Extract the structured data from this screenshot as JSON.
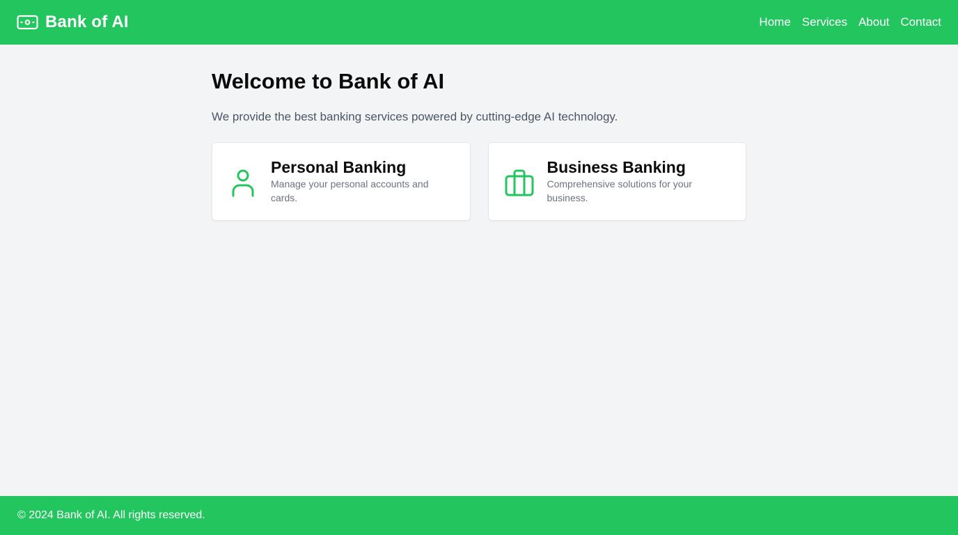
{
  "header": {
    "brand_name": "Bank of AI",
    "brand_icon": "banknote-icon",
    "nav": [
      {
        "label": "Home"
      },
      {
        "label": "Services"
      },
      {
        "label": "About"
      },
      {
        "label": "Contact"
      }
    ]
  },
  "main": {
    "title": "Welcome to Bank of AI",
    "intro": "We provide the best banking services powered by cutting-edge AI technology.",
    "cards": [
      {
        "icon": "user-icon",
        "title": "Personal Banking",
        "description": "Manage your personal accounts and cards."
      },
      {
        "icon": "briefcase-icon",
        "title": "Business Banking",
        "description": "Comprehensive solutions for your business."
      }
    ]
  },
  "footer": {
    "text": "© 2024 Bank of AI. All rights reserved."
  },
  "colors": {
    "brand_green": "#22c55e",
    "background": "#f3f4f6",
    "card_background": "#ffffff",
    "title_text": "#0b0b0b",
    "muted_text": "#6b7280"
  }
}
